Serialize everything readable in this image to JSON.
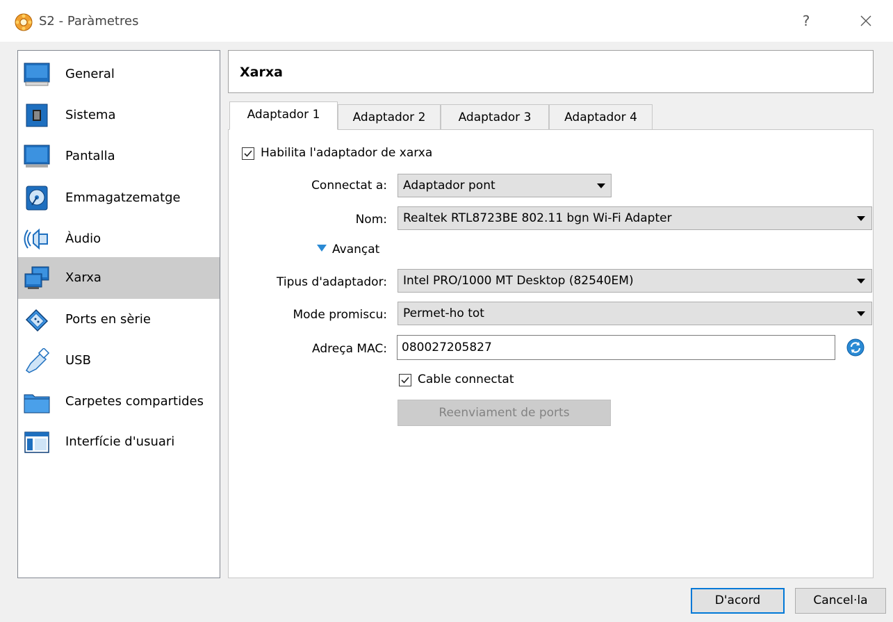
{
  "window": {
    "title": "S2 - Paràmetres",
    "help_label": "?"
  },
  "sidebar": {
    "items": [
      {
        "label": "General",
        "icon": "general-monitor-icon"
      },
      {
        "label": "Sistema",
        "icon": "chip-icon"
      },
      {
        "label": "Pantalla",
        "icon": "display-icon"
      },
      {
        "label": "Emmagatzematge",
        "icon": "storage-disk-icon"
      },
      {
        "label": "Àudio",
        "icon": "speaker-icon"
      },
      {
        "label": "Xarxa",
        "icon": "network-icon",
        "selected": true
      },
      {
        "label": "Ports en sèrie",
        "icon": "serial-port-icon"
      },
      {
        "label": "USB",
        "icon": "usb-icon"
      },
      {
        "label": "Carpetes compartides",
        "icon": "folder-icon"
      },
      {
        "label": "Interfície d'usuari",
        "icon": "user-interface-icon"
      }
    ]
  },
  "section": {
    "title": "Xarxa"
  },
  "tabs": [
    {
      "label": "Adaptador 1",
      "active": true
    },
    {
      "label": "Adaptador 2"
    },
    {
      "label": "Adaptador 3"
    },
    {
      "label": "Adaptador 4"
    }
  ],
  "adapter": {
    "enable_label": "Habilita l'adaptador de xarxa",
    "enable_checked": true,
    "attached_label": "Connectat a:",
    "attached_value": "Adaptador pont",
    "name_label": "Nom:",
    "name_value": "Realtek RTL8723BE 802.11 bgn Wi-Fi Adapter",
    "advanced_label": "Avançat",
    "adapter_type_label": "Tipus d'adaptador:",
    "adapter_type_value": "Intel PRO/1000 MT Desktop (82540EM)",
    "promisc_label": "Mode promiscu:",
    "promisc_value": "Permet-ho tot",
    "mac_label": "Adreça MAC:",
    "mac_value": "080027205827",
    "cable_label": "Cable connectat",
    "cable_checked": true,
    "port_forward_label": "Reenviament de ports"
  },
  "buttons": {
    "ok_label": "D'acord",
    "cancel_label": "Cancel·la"
  },
  "colors": {
    "accent": "#0078d7",
    "selected_bg": "#cccccc",
    "icon_blue": "#1e6fbf"
  }
}
